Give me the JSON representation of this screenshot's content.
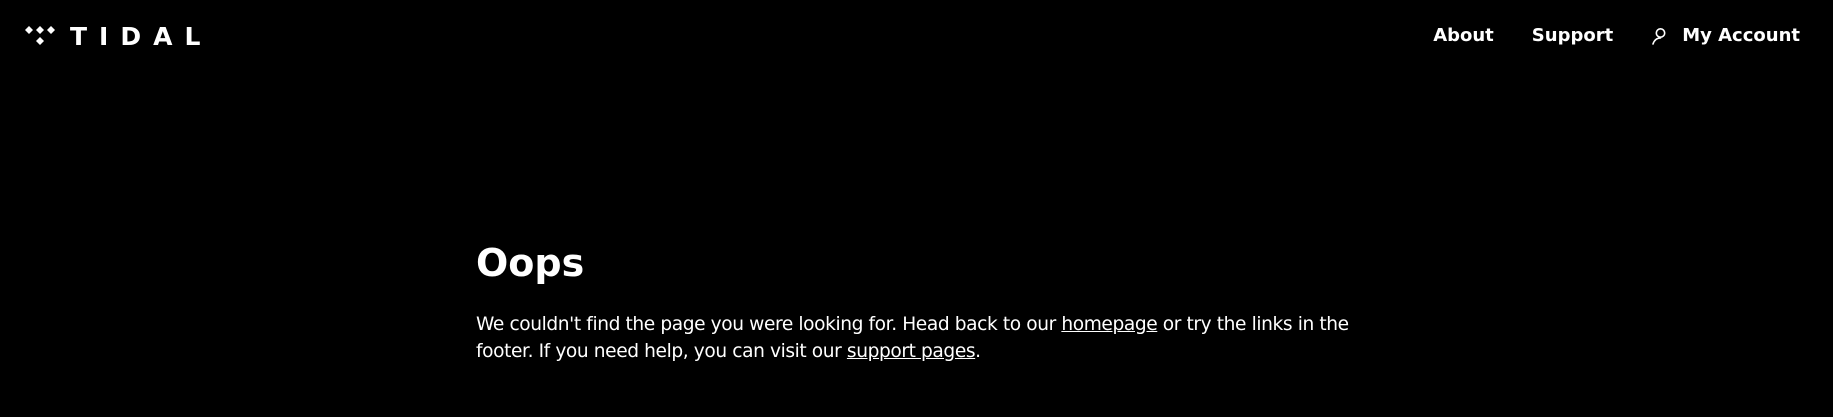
{
  "header": {
    "brand": {
      "wordmark": "TIDAL",
      "logo_icon": "tidal-diamonds-icon"
    },
    "nav": {
      "about_label": "About",
      "support_label": "Support",
      "account_label": "My Account",
      "account_icon": "user-icon"
    }
  },
  "error": {
    "title": "Oops",
    "message_part1": "We couldn't find the page you were looking for. Head back to our ",
    "homepage_link": "homepage",
    "message_part2": " or try the links in the footer. If you need help, you can visit our ",
    "support_link": "support pages",
    "message_part3": "."
  },
  "colors": {
    "background": "#000000",
    "text": "#ffffff"
  }
}
